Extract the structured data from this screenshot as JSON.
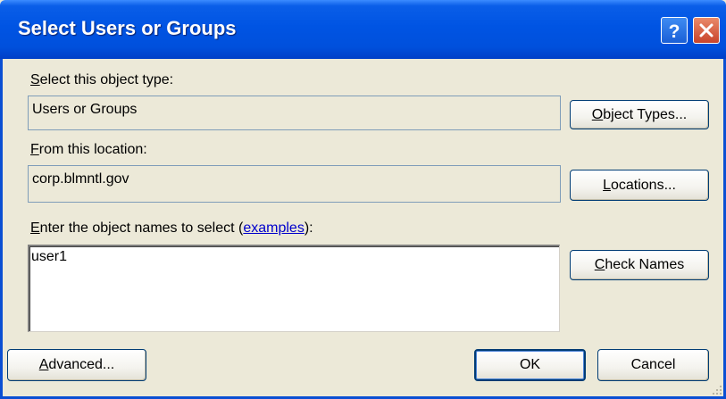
{
  "window": {
    "title": "Select Users or Groups"
  },
  "object_type": {
    "label_accel": "S",
    "label_rest": "elect this object type:",
    "value": "Users or Groups",
    "button_accel": "O",
    "button_rest": "bject Types..."
  },
  "location": {
    "label_accel": "F",
    "label_rest": "rom this location:",
    "value": "corp.blmntl.gov",
    "button_accel": "L",
    "button_rest": "ocations..."
  },
  "names": {
    "label_accel": "E",
    "label_rest": "nter the object names to select (",
    "examples_link": "examples",
    "label_end": "):",
    "value": "user1",
    "check_accel": "C",
    "check_rest": "heck Names"
  },
  "footer": {
    "advanced_accel": "A",
    "advanced_rest": "dvanced...",
    "ok_label": "OK",
    "cancel_label": "Cancel"
  },
  "colors": {
    "title_bar": "#0054e3",
    "dialog_bg": "#ece9d8",
    "close_button": "#c9442a",
    "link": "#0000cc"
  },
  "icons": {
    "help": "help-icon",
    "close": "close-icon",
    "resize": "resize-grip-icon"
  }
}
